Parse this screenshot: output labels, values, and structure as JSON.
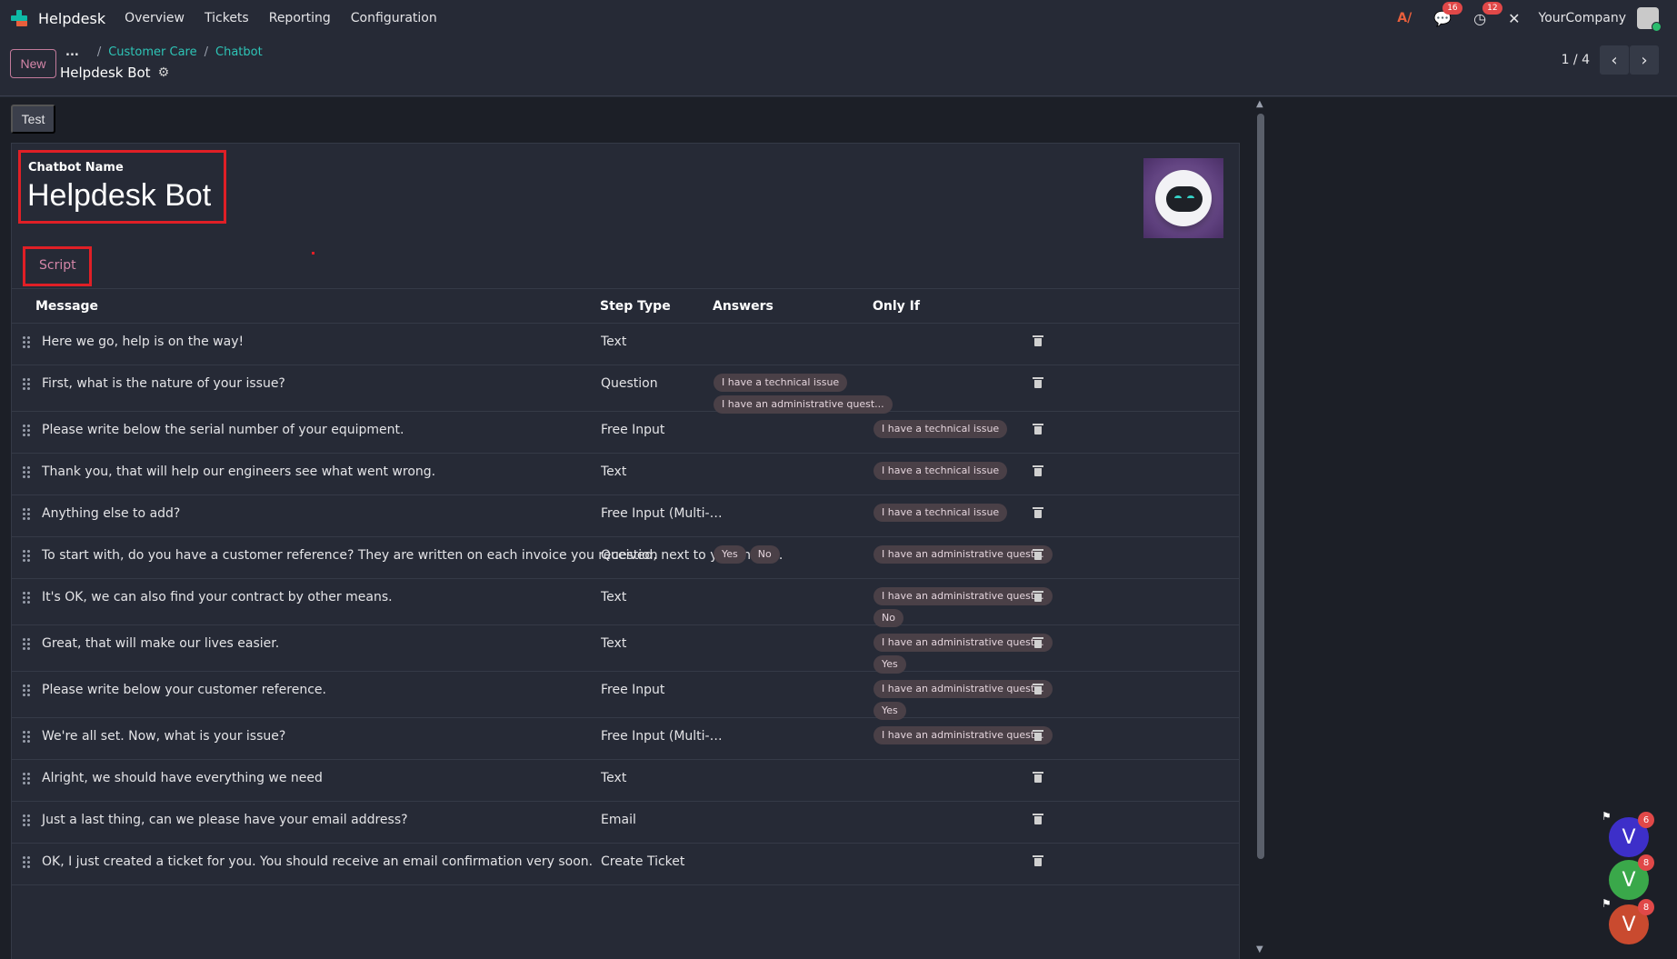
{
  "navbar": {
    "app_name": "Helpdesk",
    "menu": [
      "Overview",
      "Tickets",
      "Reporting",
      "Configuration"
    ],
    "messages_count": "16",
    "activities_count": "12",
    "company": "YourCompany"
  },
  "control_panel": {
    "new_label": "New",
    "breadcrumb_more": "...",
    "breadcrumbs": [
      "Customer Care",
      "Chatbot"
    ],
    "record_title": "Helpdesk Bot",
    "pager_value": "1 / 4"
  },
  "form": {
    "test_label": "Test",
    "chatbot_name_label": "Chatbot Name",
    "chatbot_name": "Helpdesk Bot",
    "tab_script": "Script"
  },
  "table": {
    "headers": {
      "message": "Message",
      "step_type": "Step Type",
      "answers": "Answers",
      "only_if": "Only If"
    },
    "rows": [
      {
        "message": "Here we go, help is on the way!",
        "step_type": "Text",
        "answers": [],
        "only_if": []
      },
      {
        "message": "First, what is the nature of your issue?",
        "step_type": "Question",
        "answers": [
          "I have a technical issue",
          "I have an administrative quest..."
        ],
        "only_if": []
      },
      {
        "message": "Please write below the serial number of your equipment.",
        "step_type": "Free Input",
        "answers": [],
        "only_if": [
          "I have a technical issue"
        ]
      },
      {
        "message": "Thank you, that will help our engineers see what went wrong.",
        "step_type": "Text",
        "answers": [],
        "only_if": [
          "I have a technical issue"
        ]
      },
      {
        "message": "Anything else to add?",
        "step_type": "Free Input (Multi-Li...",
        "answers": [],
        "only_if": [
          "I have a technical issue"
        ]
      },
      {
        "message": "To start with, do you have a customer reference? They are written on each invoice you received, next to your name.",
        "step_type": "Question",
        "answers": [
          "Yes",
          "No"
        ],
        "only_if": [
          "I have an administrative quest..."
        ]
      },
      {
        "message": "It's OK, we can also find your contract by other means.",
        "step_type": "Text",
        "answers": [],
        "only_if": [
          "I have an administrative quest...",
          "No"
        ]
      },
      {
        "message": "Great, that will make our lives easier.",
        "step_type": "Text",
        "answers": [],
        "only_if": [
          "I have an administrative quest...",
          "Yes"
        ]
      },
      {
        "message": "Please write below your customer reference.",
        "step_type": "Free Input",
        "answers": [],
        "only_if": [
          "I have an administrative quest...",
          "Yes"
        ]
      },
      {
        "message": "We're all set. Now, what is your issue?",
        "step_type": "Free Input (Multi-Li...",
        "answers": [],
        "only_if": [
          "I have an administrative quest..."
        ]
      },
      {
        "message": "Alright, we should have everything we need",
        "step_type": "Text",
        "answers": [],
        "only_if": []
      },
      {
        "message": "Just a last thing, can we please have your email address?",
        "step_type": "Email",
        "answers": [],
        "only_if": []
      },
      {
        "message": "OK, I just created a ticket for you. You should receive an email confirmation very soon.",
        "step_type": "Create Ticket",
        "answers": [],
        "only_if": []
      }
    ]
  },
  "chat_bubbles": [
    {
      "letter": "V",
      "count": "6",
      "color": "#3d2fc9",
      "flag": true
    },
    {
      "letter": "V",
      "count": "8",
      "color": "#3aa84a",
      "flag": false
    },
    {
      "letter": "V",
      "count": "8",
      "color": "#c94a2f",
      "flag": true
    }
  ]
}
